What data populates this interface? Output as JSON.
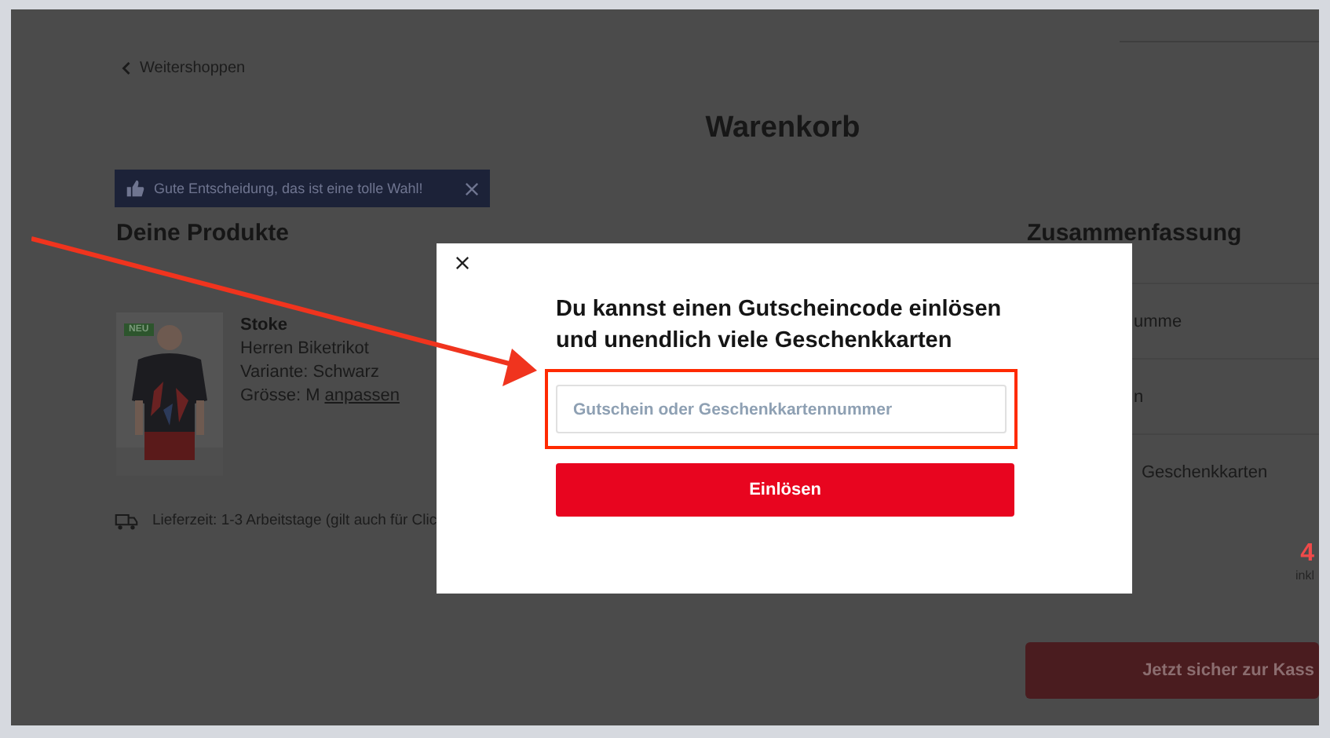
{
  "back_link": {
    "label": "Weitershoppen"
  },
  "page_title": "Warenkorb",
  "notice": {
    "text": "Gute Entscheidung, das ist eine tolle Wahl!"
  },
  "products": {
    "heading": "Deine Produkte",
    "items": [
      {
        "badge": "NEU",
        "name": "Stoke",
        "type": "Herren Biketrikot",
        "variant": "Variante: Schwarz",
        "size": "Grösse: M",
        "size_link": "anpassen"
      }
    ],
    "delivery": "Lieferzeit: 1-3 Arbeitstage (gilt auch für Clic"
  },
  "summary": {
    "heading": "Zusammenfassung",
    "rows": [
      "umme",
      "n",
      "Geschenkkarten"
    ],
    "total": "4",
    "total_note": "inkl",
    "checkout_button": "Jetzt sicher zur Kass"
  },
  "dialog": {
    "heading_lines": [
      "Du kannst einen Gutscheincode einlösen",
      "und unendlich viele Geschenkkarten"
    ],
    "input": {
      "placeholder": "Gutschein oder Geschenkkartennummer"
    },
    "submit_button": "Einlösen"
  }
}
